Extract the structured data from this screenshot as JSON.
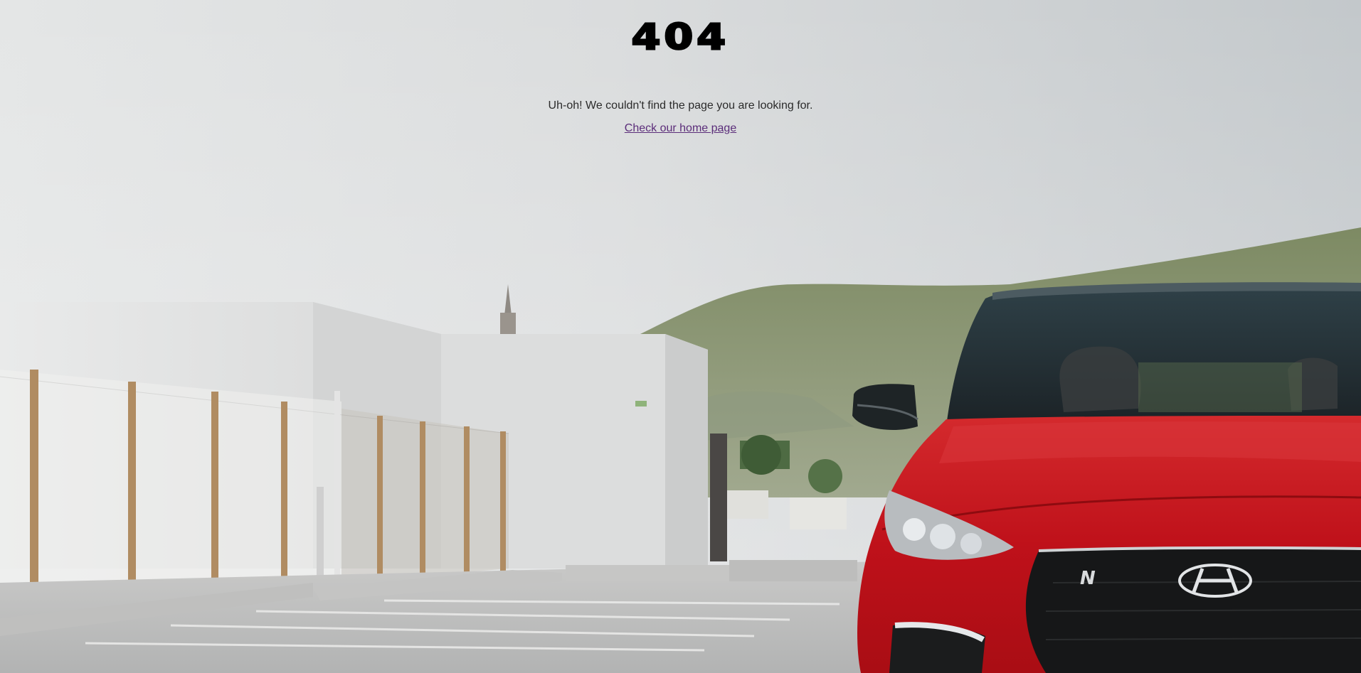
{
  "error": {
    "code": "404",
    "message": "Uh-oh! We couldn't find the page you are looking for.",
    "home_link_label": "Check our home page"
  },
  "theme": {
    "link_color": "#5b2d7a",
    "car_color": "#c8161d",
    "sky_color": "#d9dde0"
  },
  "background": {
    "emblem_text": "N",
    "logo": "hyundai-logo"
  }
}
